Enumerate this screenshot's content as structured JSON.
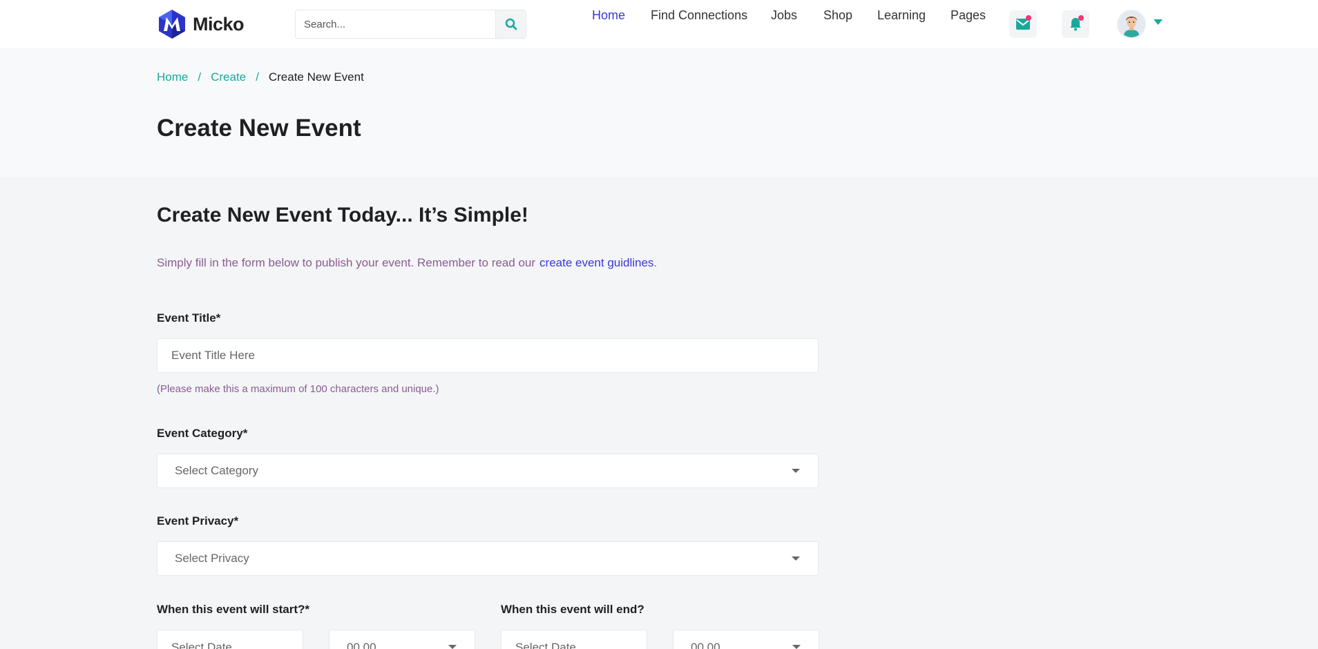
{
  "brand": {
    "name": "Micko"
  },
  "search": {
    "placeholder": "Search..."
  },
  "nav": {
    "items": [
      {
        "label": "Home",
        "active": true
      },
      {
        "label": "Find Connections",
        "active": false
      },
      {
        "label": "Jobs",
        "active": false
      },
      {
        "label": "Shop",
        "active": false
      },
      {
        "label": "Learning",
        "active": false
      },
      {
        "label": "Pages",
        "active": false
      }
    ]
  },
  "header_icons": {
    "messages": "envelope-icon",
    "notifications": "bell-icon",
    "user_menu": "chevron-down-icon"
  },
  "breadcrumb": {
    "home": "Home",
    "create": "Create",
    "sep": "/",
    "current": "Create New Event"
  },
  "page_title": "Create New Event",
  "section": {
    "title": "Create New Event Today... It’s Simple!",
    "intro_text": "Simply fill in the form below to publish your event. Remember to read our",
    "intro_link": "create event guidlines",
    "intro_end": "."
  },
  "form": {
    "title_label": "Event Title*",
    "title_placeholder": "Event Title Here",
    "title_hint": "(Please make this a maximum of 100 characters and unique.)",
    "category_label": "Event Category*",
    "category_value": "Select Category",
    "privacy_label": "Event Privacy*",
    "privacy_value": "Select Privacy",
    "start_label": "When this event will start?*",
    "end_label": "When this event will end?",
    "start_date": "Select Date",
    "start_time": "00.00",
    "end_date": "Select Date",
    "end_time": "00.00"
  },
  "colors": {
    "accent": "#19a99c",
    "brand_blue": "#3a36db",
    "muted_purple": "#8a5c91",
    "badge": "#f0357a"
  }
}
